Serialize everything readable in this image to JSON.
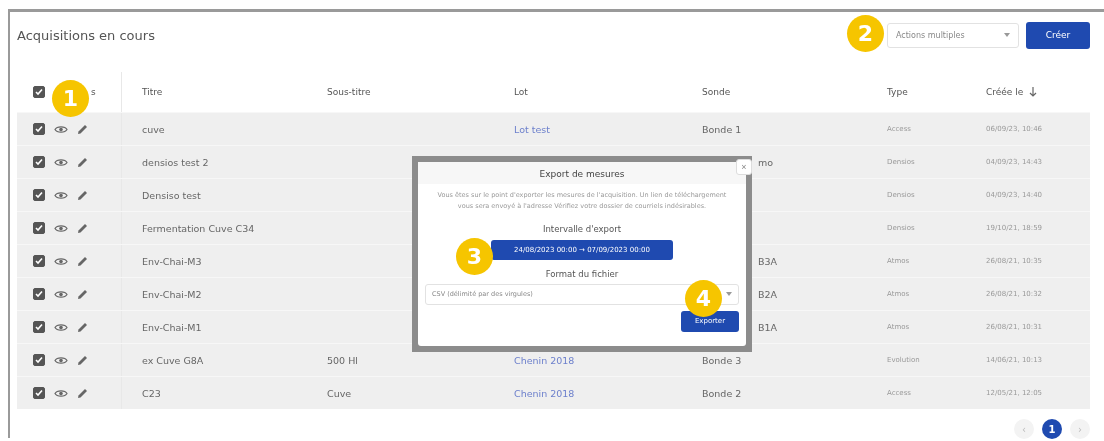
{
  "title": "Acquisitions en cours",
  "toolbar": {
    "select_placeholder": "Actions multiples",
    "create_button": "Créer"
  },
  "table": {
    "select_all_checked": true,
    "actions_header": "s",
    "columns": [
      "Titre",
      "Sous-titre",
      "Lot",
      "Sonde",
      "Type",
      "Créée le"
    ],
    "rows": [
      {
        "checked": true,
        "titre": "cuve",
        "lot": "Lot test",
        "sonde": "Bonde 1",
        "type": "Access",
        "date": "06/09/23, 10:46"
      },
      {
        "checked": true,
        "titre": "densios test 2",
        "sonde": "mo",
        "covered": true,
        "type": "Densios",
        "date": "04/09/23, 14:43"
      },
      {
        "checked": true,
        "titre": "Densiso test",
        "type": "Densios",
        "date": "04/09/23, 14:40"
      },
      {
        "checked": true,
        "titre": "Fermentation Cuve C34",
        "type": "Densios",
        "date": "19/10/21, 18:59"
      },
      {
        "checked": true,
        "titre": "Env-Chai-M3",
        "sonde": "B3A",
        "covered": true,
        "type": "Atmos",
        "date": "26/08/21, 10:35"
      },
      {
        "checked": true,
        "titre": "Env-Chai-M2",
        "sonde": "B2A",
        "covered": true,
        "type": "Atmos",
        "date": "26/08/21, 10:32"
      },
      {
        "checked": true,
        "titre": "Env-Chai-M1",
        "sonde": "B1A",
        "covered": true,
        "type": "Atmos",
        "date": "26/08/21, 10:31"
      },
      {
        "checked": true,
        "titre": "ex Cuve G8A",
        "sous_titre": "500 Hl",
        "lot": "Chenin 2018",
        "sonde": "Bonde 3",
        "type": "Evolution",
        "date": "14/06/21, 10:13"
      },
      {
        "checked": true,
        "titre": "C23",
        "sous_titre": "Cuve",
        "lot": "Chenin 2018",
        "sonde": "Bonde 2",
        "type": "Access",
        "date": "12/05/21, 12:05"
      }
    ]
  },
  "pagination": {
    "prev": "‹",
    "pages": [
      {
        "label": "1",
        "selected": true
      }
    ],
    "next": "›"
  },
  "modal": {
    "title": "Export de mesures",
    "close": "×",
    "message": "Vous êtes sur le point d'exporter les mesures de l'acquisition. Un lien de téléchargement vous sera envoyé à l'adresse Vérifiez votre dossier de courriels indésirables.",
    "interval_label": "Intervalle d'export",
    "interval": "24/08/2023 00:00 → 07/09/2023 00:00",
    "format_label": "Format du fichier",
    "format": "CSV (délimité par des virgules)",
    "export_button": "Exporter"
  },
  "callouts": [
    {
      "label": "1"
    },
    {
      "label": "2"
    },
    {
      "label": "3"
    },
    {
      "label": "4"
    }
  ]
}
